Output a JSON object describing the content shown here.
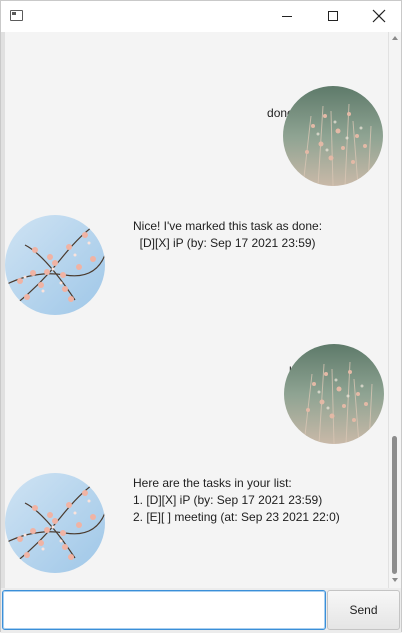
{
  "window": {
    "title": "",
    "controls": {
      "minimize": "minimize",
      "maximize": "maximize",
      "close": "close"
    }
  },
  "messages": [
    {
      "sender": "user",
      "lines": [
        "done 1"
      ]
    },
    {
      "sender": "bot",
      "lines": [
        "Nice! I've marked this task as done:",
        "  [D][X] iP (by: Sep 17 2021 23:59)"
      ]
    },
    {
      "sender": "user",
      "lines": [
        "list"
      ]
    },
    {
      "sender": "bot",
      "lines": [
        "Here are the tasks in your list:",
        "1. [D][X] iP (by: Sep 17 2021 23:59)",
        "2. [E][ ] meeting (at: Sep 23 2021 22:0)"
      ]
    }
  ],
  "input": {
    "value": "",
    "placeholder": ""
  },
  "send_label": "Send",
  "colors": {
    "focus": "#3a8fd8",
    "scroll_thumb": "#8d8d8d"
  },
  "icons": {
    "user_avatar": "grass-photo-avatar",
    "bot_avatar": "blossom-photo-avatar"
  }
}
